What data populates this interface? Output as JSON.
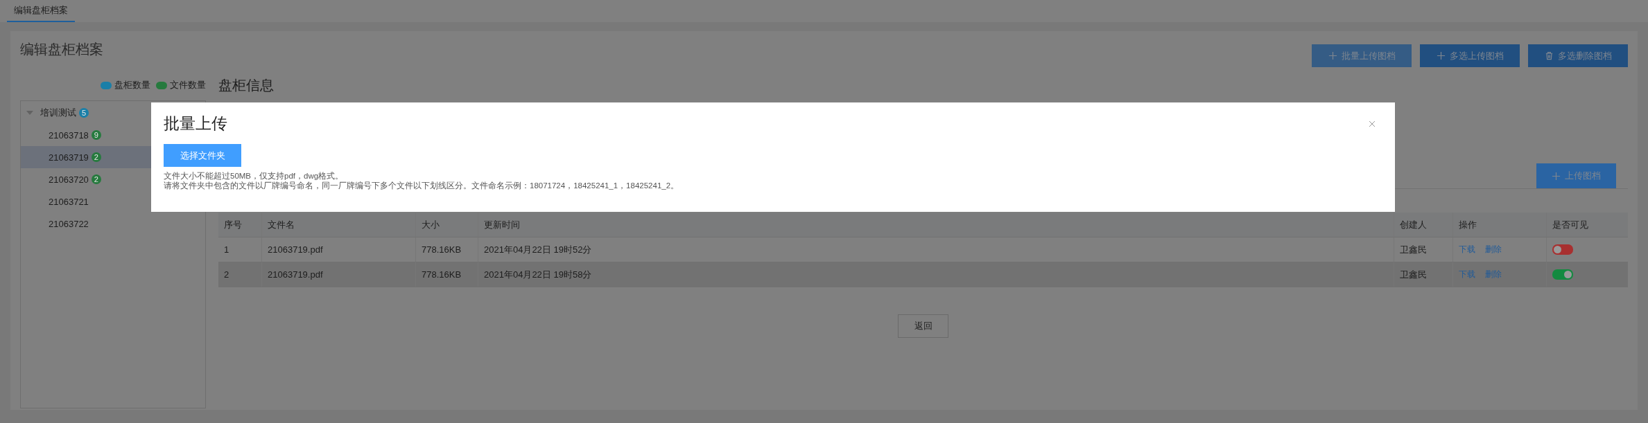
{
  "tabs": [
    {
      "label": "编辑盘柜档案",
      "selected": true
    }
  ],
  "page_title": "编辑盘柜档案",
  "toolbar_buttons": [
    {
      "label": "批量上传图档",
      "kind": "add",
      "active": true
    },
    {
      "label": "多选上传图档",
      "kind": "add",
      "active": false
    },
    {
      "label": "多选删除图档",
      "kind": "delete",
      "active": false
    }
  ],
  "legend": [
    {
      "label": "盘柜数量",
      "color": "#1a7fa8"
    },
    {
      "label": "文件数量",
      "color": "#267a3e"
    }
  ],
  "tree": [
    {
      "label": "培训测试",
      "count": "5",
      "color": "#1a7fa8",
      "expanded": true,
      "selected": false,
      "children": [
        {
          "label": "21063718",
          "count": "9",
          "color": "#267a3e",
          "selected": false
        },
        {
          "label": "21063719",
          "count": "2",
          "color": "#267a3e",
          "selected": true
        },
        {
          "label": "21063720",
          "count": "2",
          "color": "#267a3e",
          "selected": false
        },
        {
          "label": "21063721",
          "selected": false
        },
        {
          "label": "21063722",
          "selected": false
        }
      ]
    }
  ],
  "section_title": "盘柜信息",
  "upload_button": {
    "label": "上传图档"
  },
  "table": {
    "columns": [
      "序号",
      "文件名",
      "大小",
      "更新时间",
      "创建人",
      "操作",
      "是否可见"
    ],
    "rows": [
      {
        "cells": [
          "1",
          "21063719.pdf",
          "778.16KB",
          "2021年04月22日 19时52分",
          "卫鑫民"
        ],
        "actions": [
          "下载",
          "删除"
        ],
        "visible": false,
        "selected": false
      },
      {
        "cells": [
          "2",
          "21063719.pdf",
          "778.16KB",
          "2021年04月22日 19时58分",
          "卫鑫民"
        ],
        "actions": [
          "下载",
          "删除"
        ],
        "visible": true,
        "selected": true
      }
    ]
  },
  "back_button": "返回",
  "dialog": {
    "title": "批量上传",
    "button": "选择文件夹",
    "notes": [
      "文件大小不能超过50MB，仅支持pdf，dwg格式。",
      "请将文件夹中包含的文件以厂牌编号命名，同一厂牌编号下多个文件以下划线区分。文件命名示例：18071724，18425241_1，18425241_2。"
    ]
  }
}
